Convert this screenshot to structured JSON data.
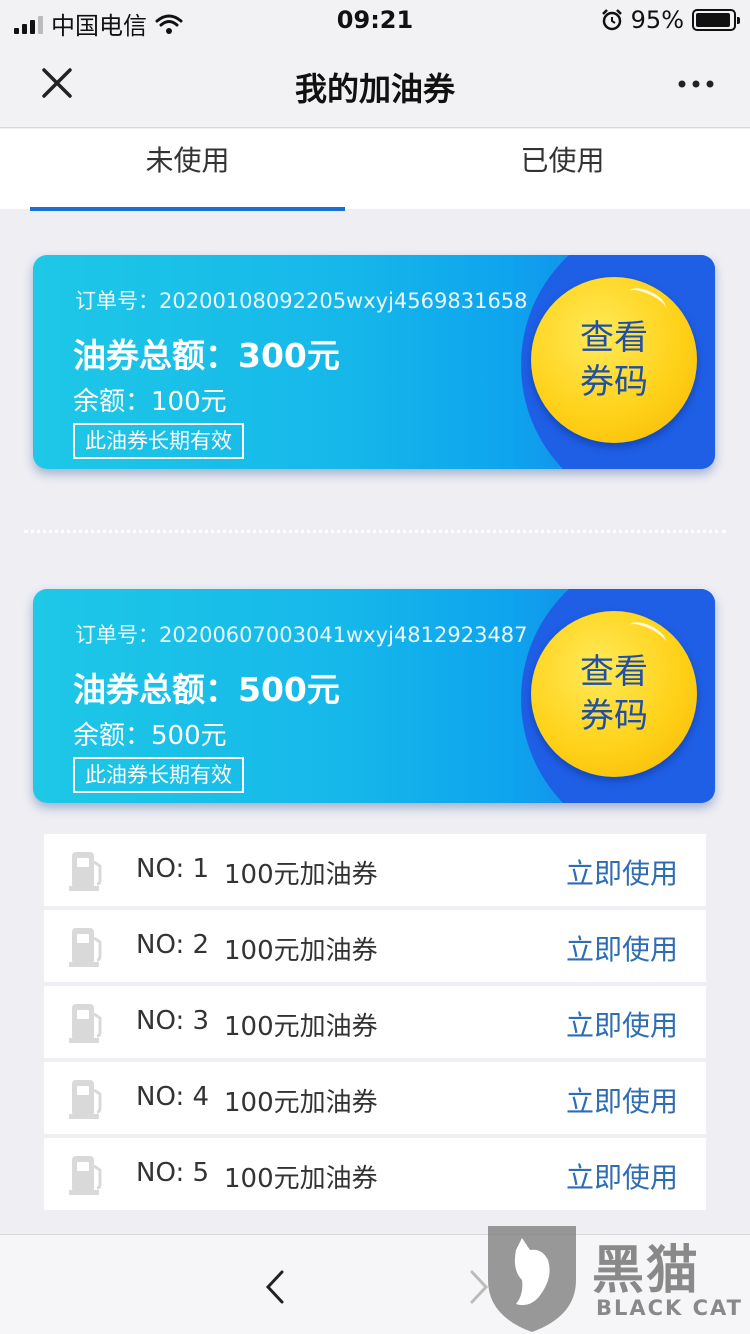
{
  "status_bar": {
    "carrier": "中国电信",
    "time": "09:21",
    "battery_percent": "95%",
    "battery_level": 0.95
  },
  "nav": {
    "title": "我的加油券",
    "close_icon": "close-icon",
    "more_icon": "more-icon"
  },
  "tabs": [
    {
      "label": "未使用",
      "active": true
    },
    {
      "label": "已使用",
      "active": false
    }
  ],
  "coupons": [
    {
      "order": "订单号：20200108092205wxyj4569831658",
      "total": "油券总额：300元",
      "balance": "余额：100元",
      "validity": "此油券长期有效",
      "button_line1": "查看",
      "button_line2": "券码"
    },
    {
      "order": "订单号：20200607003041wxyj4812923487",
      "total": "油券总额：500元",
      "balance": "余额：500元",
      "validity": "此油券长期有效",
      "button_line1": "查看",
      "button_line2": "券码"
    }
  ],
  "tickets": [
    {
      "no": "NO: 1",
      "name": "100元加油券",
      "action": "立即使用"
    },
    {
      "no": "NO: 2",
      "name": "100元加油券",
      "action": "立即使用"
    },
    {
      "no": "NO: 3",
      "name": "100元加油券",
      "action": "立即使用"
    },
    {
      "no": "NO: 4",
      "name": "100元加油券",
      "action": "立即使用"
    },
    {
      "no": "NO: 5",
      "name": "100元加油券",
      "action": "立即使用"
    }
  ],
  "watermark": {
    "cn": "黑猫",
    "en": "BLACK CAT"
  },
  "colors": {
    "accent": "#1a6fd6",
    "link": "#2f6db3",
    "coin": "#ffd21a"
  }
}
